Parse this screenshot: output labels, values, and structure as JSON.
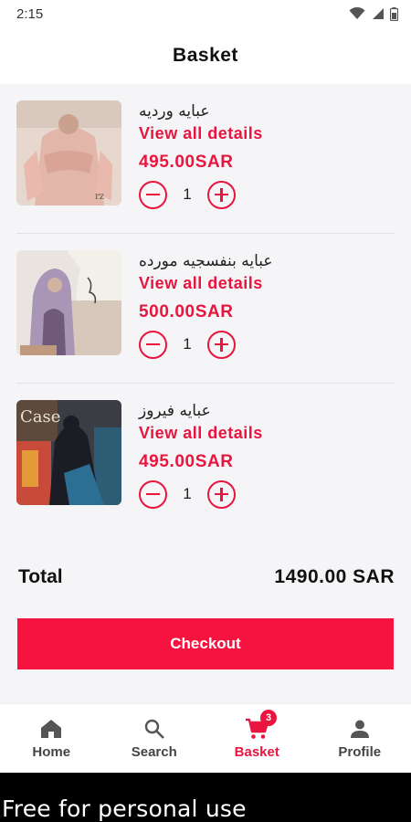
{
  "status_bar": {
    "time": "2:15"
  },
  "header": {
    "title": "Basket"
  },
  "items": [
    {
      "name": "عبايه ورديه",
      "link": "View all details",
      "price": "495.00SAR",
      "qty": "1"
    },
    {
      "name": "عبايه بنفسجيه مورده",
      "link": "View all details",
      "price": "500.00SAR",
      "qty": "1"
    },
    {
      "name": "عبايه فيروز",
      "link": "View all details",
      "price": "495.00SAR",
      "qty": "1"
    }
  ],
  "total": {
    "label": "Total",
    "value": "1490.00 SAR"
  },
  "checkout_label": "Checkout",
  "nav": {
    "home": "Home",
    "search": "Search",
    "basket": "Basket",
    "basket_badge": "3",
    "profile": "Profile"
  },
  "watermark": "Free for personal use",
  "colors": {
    "accent": "#e8153f",
    "checkout": "#f7133f",
    "background": "#f5f5f7"
  }
}
